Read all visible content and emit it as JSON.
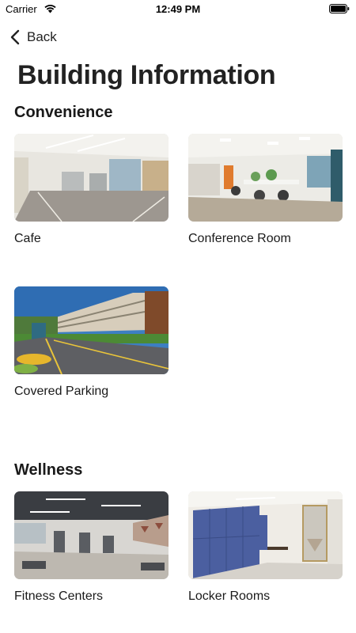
{
  "status_bar": {
    "carrier": "Carrier",
    "time": "12:49 PM"
  },
  "nav": {
    "back_label": "Back"
  },
  "page": {
    "title": "Building Information"
  },
  "sections": [
    {
      "title": "Convenience",
      "items": [
        {
          "label": "Cafe",
          "image": "cafe-photo"
        },
        {
          "label": "Conference Room",
          "image": "conference-room-photo"
        },
        {
          "label": "Covered Parking",
          "image": "covered-parking-photo"
        }
      ]
    },
    {
      "title": "Wellness",
      "items": [
        {
          "label": "Fitness Centers",
          "image": "fitness-center-photo"
        },
        {
          "label": "Locker Rooms",
          "image": "locker-room-photo"
        }
      ]
    }
  ]
}
